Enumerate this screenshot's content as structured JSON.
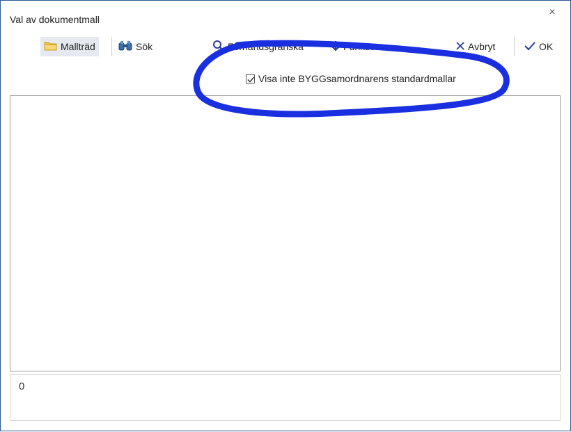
{
  "window": {
    "title": "Val av dokumentmall",
    "close_glyph": "×"
  },
  "toolbar": {
    "malltrad_label": "Mallträd",
    "sok_label": "Sök",
    "forhandsgranska_label": "Förhandsgranska",
    "funktioner_label": "Funktioner",
    "avbryt_label": "Avbryt",
    "ok_label": "OK",
    "icons": [
      "folder-icon",
      "binoculars-icon",
      "magnifier-icon",
      "arrow-down-icon",
      "x-icon",
      "checkmark-icon"
    ]
  },
  "options": {
    "hide_standard_templates_label": "Visa inte BYGGsamordnarens standardmallar",
    "hide_standard_templates_checked": true
  },
  "status": {
    "count": "0"
  },
  "colors": {
    "accent": "#1a2fe0",
    "window_border": "#2b5797",
    "active_tab_bg": "#e6eaf0",
    "icon_blue": "#2a3b9a"
  }
}
